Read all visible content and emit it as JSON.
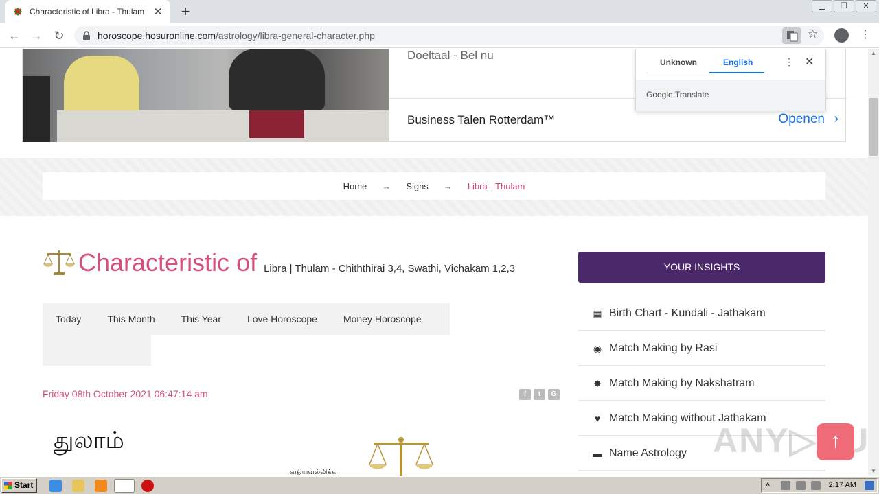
{
  "browser": {
    "tab_title": "Characteristic of Libra - Thulam",
    "url_host": "horoscope.hosuronline.com",
    "url_path": "/astrology/libra-general-character.php"
  },
  "ad": {
    "line1": "Doeltaal - Bel nu",
    "line2": "Business Talen Rotterdam™",
    "cta": "Openen"
  },
  "translate_popup": {
    "lang_source": "Unknown",
    "lang_target": "English",
    "brand": "Google",
    "brand_suffix": "Translate"
  },
  "breadcrumb": {
    "home": "Home",
    "signs": "Signs",
    "current": "Libra - Thulam"
  },
  "page": {
    "title": "Characteristic of",
    "subtitle": "Libra | Thulam - Chiththirai 3,4, Swathi, Vichakam 1,2,3",
    "tabs": [
      "Today",
      "This Month",
      "This Year",
      "Love Horoscope",
      "Money Horoscope"
    ],
    "date": "Friday 08th October 2021 06:47:14 am",
    "tamil_heading": "துலாம்",
    "tamil_small": "வதியவல்லிக்க"
  },
  "sidebar": {
    "header": "YOUR INSIGHTS",
    "items": [
      {
        "label": "Birth Chart - Kundali - Jathakam",
        "icon": "calendar-icon"
      },
      {
        "label": "Match Making by Rasi",
        "icon": "eye-icon"
      },
      {
        "label": "Match Making by Nakshatram",
        "icon": "star-badge-icon"
      },
      {
        "label": "Match Making without Jathakam",
        "icon": "heart-icon"
      },
      {
        "label": "Name Astrology",
        "icon": "briefcase-icon"
      }
    ]
  },
  "taskbar": {
    "start": "Start",
    "clock": "2:17 AM"
  },
  "colors": {
    "accent_pink": "#d4507e",
    "insights_purple": "#4b2869",
    "link_blue": "#1a73e8"
  }
}
